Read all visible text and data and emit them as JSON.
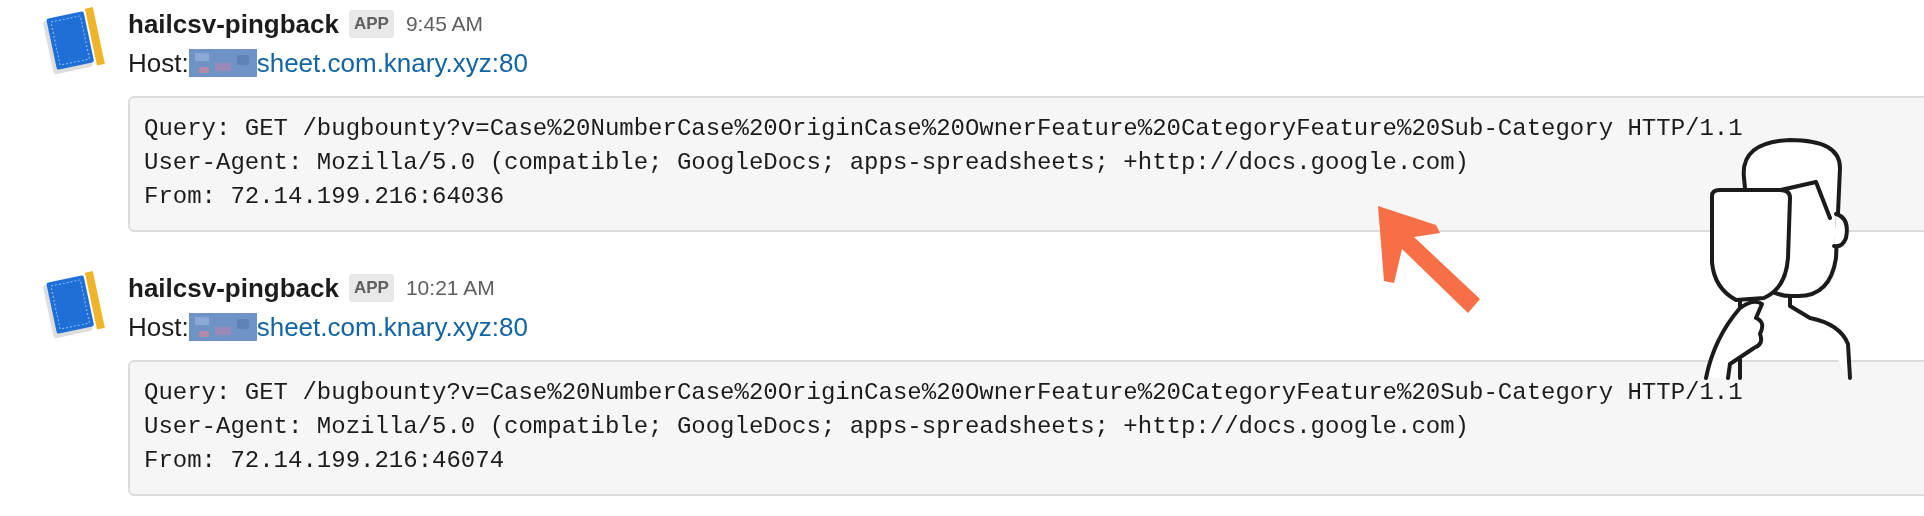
{
  "messages": [
    {
      "sender": "hailcsv-pingback",
      "badge": "APP",
      "time": "9:45 AM",
      "host_label": "Host:",
      "host_redacted": true,
      "host_link": "sheet.com.knary.xyz:80",
      "code_lines": [
        "Query: GET /bugbounty?v=Case%20NumberCase%20OriginCase%20OwnerFeature%20CategoryFeature%20Sub-Category HTTP/1.1",
        "User-Agent: Mozilla/5.0 (compatible; GoogleDocs; apps-spreadsheets; +http://docs.google.com)",
        "From: 72.14.199.216:64036"
      ]
    },
    {
      "sender": "hailcsv-pingback",
      "badge": "APP",
      "time": "10:21 AM",
      "host_label": "Host:",
      "host_redacted": true,
      "host_link": "sheet.com.knary.xyz:80",
      "code_lines": [
        "Query: GET /bugbounty?v=Case%20NumberCase%20OriginCase%20OwnerFeature%20CategoryFeature%20Sub-Category HTTP/1.1",
        "User-Agent: Mozilla/5.0 (compatible; GoogleDocs; apps-spreadsheets; +http://docs.google.com)",
        "From: 72.14.199.216:46074"
      ]
    }
  ]
}
